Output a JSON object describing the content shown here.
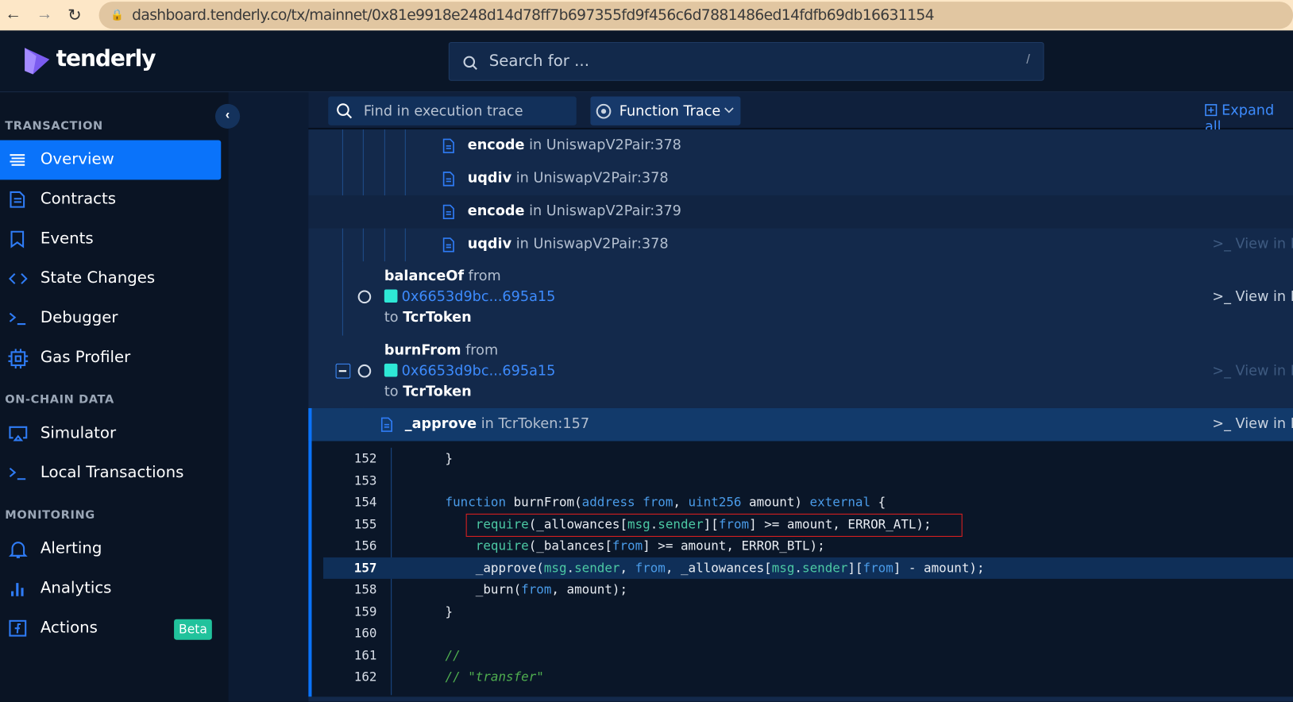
{
  "browser": {
    "url": "dashboard.tenderly.co/tx/mainnet/0x81e9918e248d14d78ff7b697355fd9f456c6d7881486ed14fdfb69db16631154"
  },
  "header": {
    "logo": "tenderly",
    "search_placeholder": "Search for ...",
    "search_shortcut": "/"
  },
  "sidebar": {
    "sections": [
      "TRANSACTION",
      "ON-CHAIN DATA",
      "MONITORING"
    ],
    "items": [
      {
        "label": "Overview",
        "icon": "list-icon",
        "active": true
      },
      {
        "label": "Contracts",
        "icon": "document-icon"
      },
      {
        "label": "Events",
        "icon": "bookmark-icon"
      },
      {
        "label": "State Changes",
        "icon": "code-icon"
      },
      {
        "label": "Debugger",
        "icon": "terminal-icon"
      },
      {
        "label": "Gas Profiler",
        "icon": "chip-icon"
      },
      {
        "label": "Simulator",
        "icon": "monitor-icon"
      },
      {
        "label": "Local Transactions",
        "icon": "terminal-icon"
      },
      {
        "label": "Alerting",
        "icon": "bell-icon"
      },
      {
        "label": "Analytics",
        "icon": "bar-chart-icon"
      },
      {
        "label": "Actions",
        "icon": "function-icon",
        "badge": "Beta"
      }
    ]
  },
  "toolbar": {
    "find_placeholder": "Find in execution trace",
    "mode": "Function Trace",
    "expand_all": "Expand all"
  },
  "trace": {
    "in": "in",
    "from": "from",
    "to": "to",
    "view": "View in Debugger",
    "rows": [
      {
        "fn": "encode",
        "loc": "UniswapV2Pair:378"
      },
      {
        "fn": "uqdiv",
        "loc": "UniswapV2Pair:378"
      },
      {
        "fn": "encode",
        "loc": "UniswapV2Pair:379"
      },
      {
        "fn": "uqdiv",
        "loc": "UniswapV2Pair:378"
      }
    ],
    "calls": [
      {
        "fn": "balanceOf",
        "address": "0x6653d9bc...695a15",
        "target": "TcrToken"
      },
      {
        "fn": "burnFrom",
        "address": "0x6653d9bc...695a15",
        "target": "TcrToken"
      }
    ],
    "selected": {
      "fn": "_approve",
      "loc": "TcrToken:157"
    }
  },
  "code": {
    "highlight_line": 157,
    "boxed_line": 155,
    "lines": [
      {
        "n": "152",
        "tokens": [
          [
            "    }",
            ""
          ]
        ]
      },
      {
        "n": "153",
        "tokens": []
      },
      {
        "n": "154",
        "tokens": [
          [
            "    ",
            ""
          ],
          [
            "function",
            "k"
          ],
          [
            " burnFrom(",
            ""
          ],
          [
            "address",
            "k"
          ],
          [
            " ",
            ""
          ],
          [
            "from",
            "k"
          ],
          [
            ", ",
            ""
          ],
          [
            "uint256",
            "k"
          ],
          [
            " amount) ",
            ""
          ],
          [
            "external",
            "k"
          ],
          [
            " {",
            ""
          ]
        ]
      },
      {
        "n": "155",
        "tokens": [
          [
            "        ",
            ""
          ],
          [
            "require",
            "g"
          ],
          [
            "(_allowances[",
            ""
          ],
          [
            "msg",
            "g"
          ],
          [
            ".",
            ""
          ],
          [
            "sender",
            "g"
          ],
          [
            "][",
            ""
          ],
          [
            "from",
            "k"
          ],
          [
            "] >= amount, ERROR_ATL);",
            ""
          ]
        ]
      },
      {
        "n": "156",
        "tokens": [
          [
            "        ",
            ""
          ],
          [
            "require",
            "g"
          ],
          [
            "(_balances[",
            ""
          ],
          [
            "from",
            "k"
          ],
          [
            "] >= amount, ERROR_BTL);",
            ""
          ]
        ]
      },
      {
        "n": "157",
        "tokens": [
          [
            "        _approve(",
            ""
          ],
          [
            "msg",
            "g"
          ],
          [
            ".",
            ""
          ],
          [
            "sender",
            "g"
          ],
          [
            ", ",
            ""
          ],
          [
            "from",
            "k"
          ],
          [
            ", _allowances[",
            ""
          ],
          [
            "msg",
            "g"
          ],
          [
            ".",
            ""
          ],
          [
            "sender",
            "g"
          ],
          [
            "][",
            ""
          ],
          [
            "from",
            "k"
          ],
          [
            "] - amount);",
            ""
          ]
        ]
      },
      {
        "n": "158",
        "tokens": [
          [
            "        _burn(",
            ""
          ],
          [
            "from",
            "k"
          ],
          [
            ", amount);",
            ""
          ]
        ]
      },
      {
        "n": "159",
        "tokens": [
          [
            "    }",
            ""
          ]
        ]
      },
      {
        "n": "160",
        "tokens": []
      },
      {
        "n": "161",
        "tokens": [
          [
            "    ",
            ""
          ],
          [
            "//",
            "c"
          ]
        ]
      },
      {
        "n": "162",
        "tokens": [
          [
            "    ",
            ""
          ],
          [
            "// \"transfer\"",
            "c"
          ]
        ]
      }
    ]
  },
  "colors": {
    "accent": "#0a73fa",
    "beta": "#21c29c",
    "address_swatch": "#2ee8d6",
    "error_box": "#e02020"
  }
}
